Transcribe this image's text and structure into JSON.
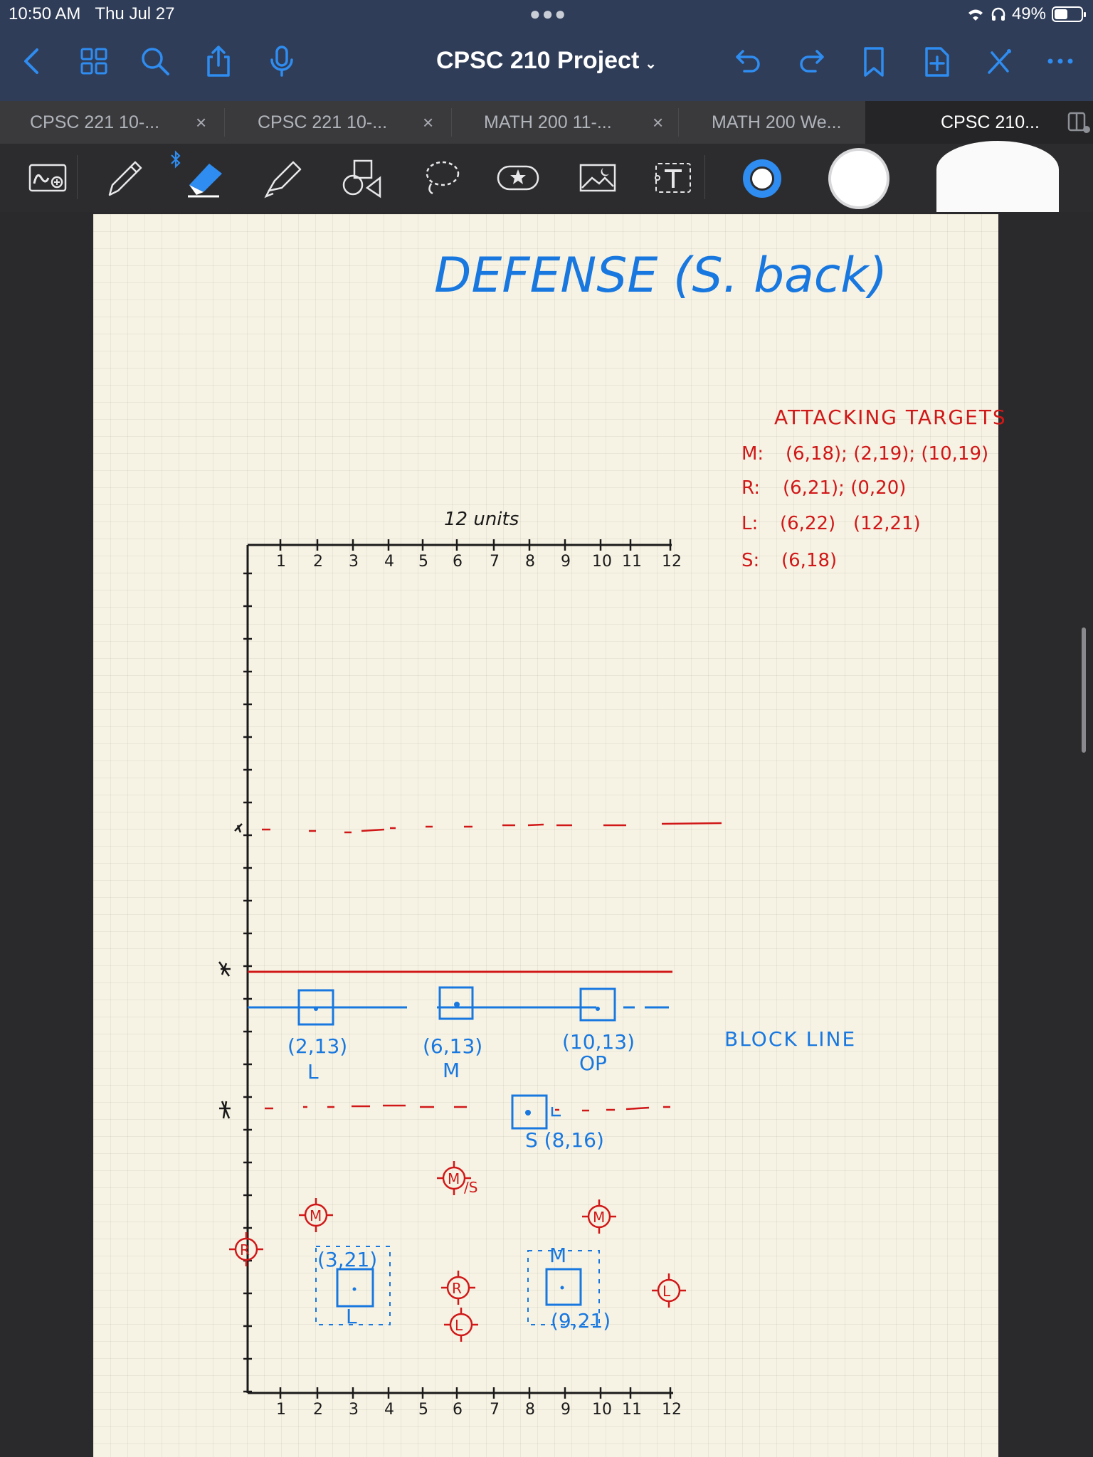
{
  "status": {
    "time": "10:50 AM",
    "date": "Thu Jul 27",
    "battery": "49%"
  },
  "doc_title": "CPSC 210 Project",
  "tabs": [
    {
      "label": "CPSC 221 10-...",
      "active": false
    },
    {
      "label": "CPSC 221 10-...",
      "active": false
    },
    {
      "label": "MATH 200 11-...",
      "active": false
    },
    {
      "label": "MATH 200 We...",
      "active": false
    },
    {
      "label": "CPSC 210...",
      "active": true
    }
  ],
  "colors": {
    "accent": "#2f8cf0",
    "nav_bg": "#2f3d58",
    "ink_blue": "#1878e0",
    "ink_red": "#d01818",
    "ink_black": "#1a1a1a",
    "paper": "#f7f3e4"
  },
  "note": {
    "heading": "DEFENSE (S. back)",
    "attack_title": "ATTACKING TARGETS",
    "attack_rows": [
      {
        "label": "M:",
        "value": "(6,18); (2,19); (10,19)"
      },
      {
        "label": "R:",
        "value": "(6,21); (0,20)"
      },
      {
        "label": "L:",
        "value": "(6,22)   (12,21)"
      },
      {
        "label": "S:",
        "value": "(6,18)"
      }
    ],
    "units_label": "12 units",
    "axis_ticks": [
      "1",
      "2",
      "3",
      "4",
      "5",
      "6",
      "7",
      "8",
      "9",
      "10",
      "11",
      "12"
    ],
    "block_line": "BLOCK LINE",
    "defenders": [
      {
        "coord": "(2,13)",
        "role": "L"
      },
      {
        "coord": "(6,13)",
        "role": "M"
      },
      {
        "coord": "(10,13)",
        "role": "OP"
      },
      {
        "coord": "S (8,16)",
        "role": ""
      },
      {
        "coord": "(3,21)",
        "role": "L"
      },
      {
        "coord": "(9,21)",
        "role": "M"
      }
    ],
    "target_marks": [
      "M",
      "M/S",
      "M",
      "R",
      "R",
      "L",
      "L"
    ]
  }
}
